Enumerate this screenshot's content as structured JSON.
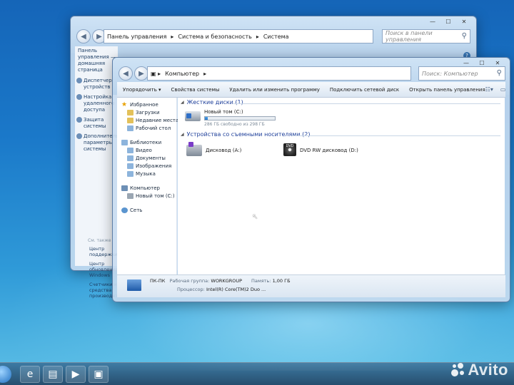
{
  "back_window": {
    "breadcrumbs": [
      "Панель управления",
      "Система и безопасность",
      "Система"
    ],
    "search_placeholder": "Поиск в панели управления",
    "left_title": "Панель управления — домашняя страница",
    "left_links": [
      "Диспетчер устройств",
      "Настройка удаленного доступа",
      "Защита системы",
      "Дополнительные параметры системы"
    ],
    "see_also": "См. также",
    "footer_links": [
      "Центр поддержки",
      "Центр обновления Windows",
      "Счетчики и средства производительности"
    ]
  },
  "front_window": {
    "breadcrumb": "Компьютер",
    "search_placeholder": "Поиск: Компьютер",
    "toolbar": {
      "organize": "Упорядочить ▾",
      "system_properties": "Свойства системы",
      "uninstall": "Удалить или изменить программу",
      "map_drive": "Подключить сетевой диск",
      "open_control_panel": "Открыть панель управления"
    },
    "nav": {
      "favorites": "Избранное",
      "favorites_items": [
        "Загрузки",
        "Недавние места",
        "Рабочий стол"
      ],
      "libraries": "Библиотеки",
      "libraries_items": [
        "Видео",
        "Документы",
        "Изображения",
        "Музыка"
      ],
      "computer": "Компьютер",
      "computer_items": [
        "Новый том (C:)"
      ],
      "network": "Сеть"
    },
    "hard_disks_header": "Жесткие диски (1)",
    "removable_header": "Устройства со съемными носителями (2)",
    "drive_c": {
      "name": "Новый том (C:)",
      "free_text": "286 ГБ свободно из 298 ГБ",
      "used_fraction": 0.04
    },
    "floppy": "Дисковод (A:)",
    "dvd": "DVD RW дисковод (D:)",
    "details": {
      "pc_name": "ПК-ПК",
      "workgroup_label": "Рабочая группа:",
      "workgroup": "WORKGROUP",
      "memory_label": "Память:",
      "memory": "1,00 ГБ",
      "cpu_label": "Процессор:",
      "cpu": "Intel(R) Core(TM)2 Duo ..."
    }
  },
  "watermark": "Avito"
}
